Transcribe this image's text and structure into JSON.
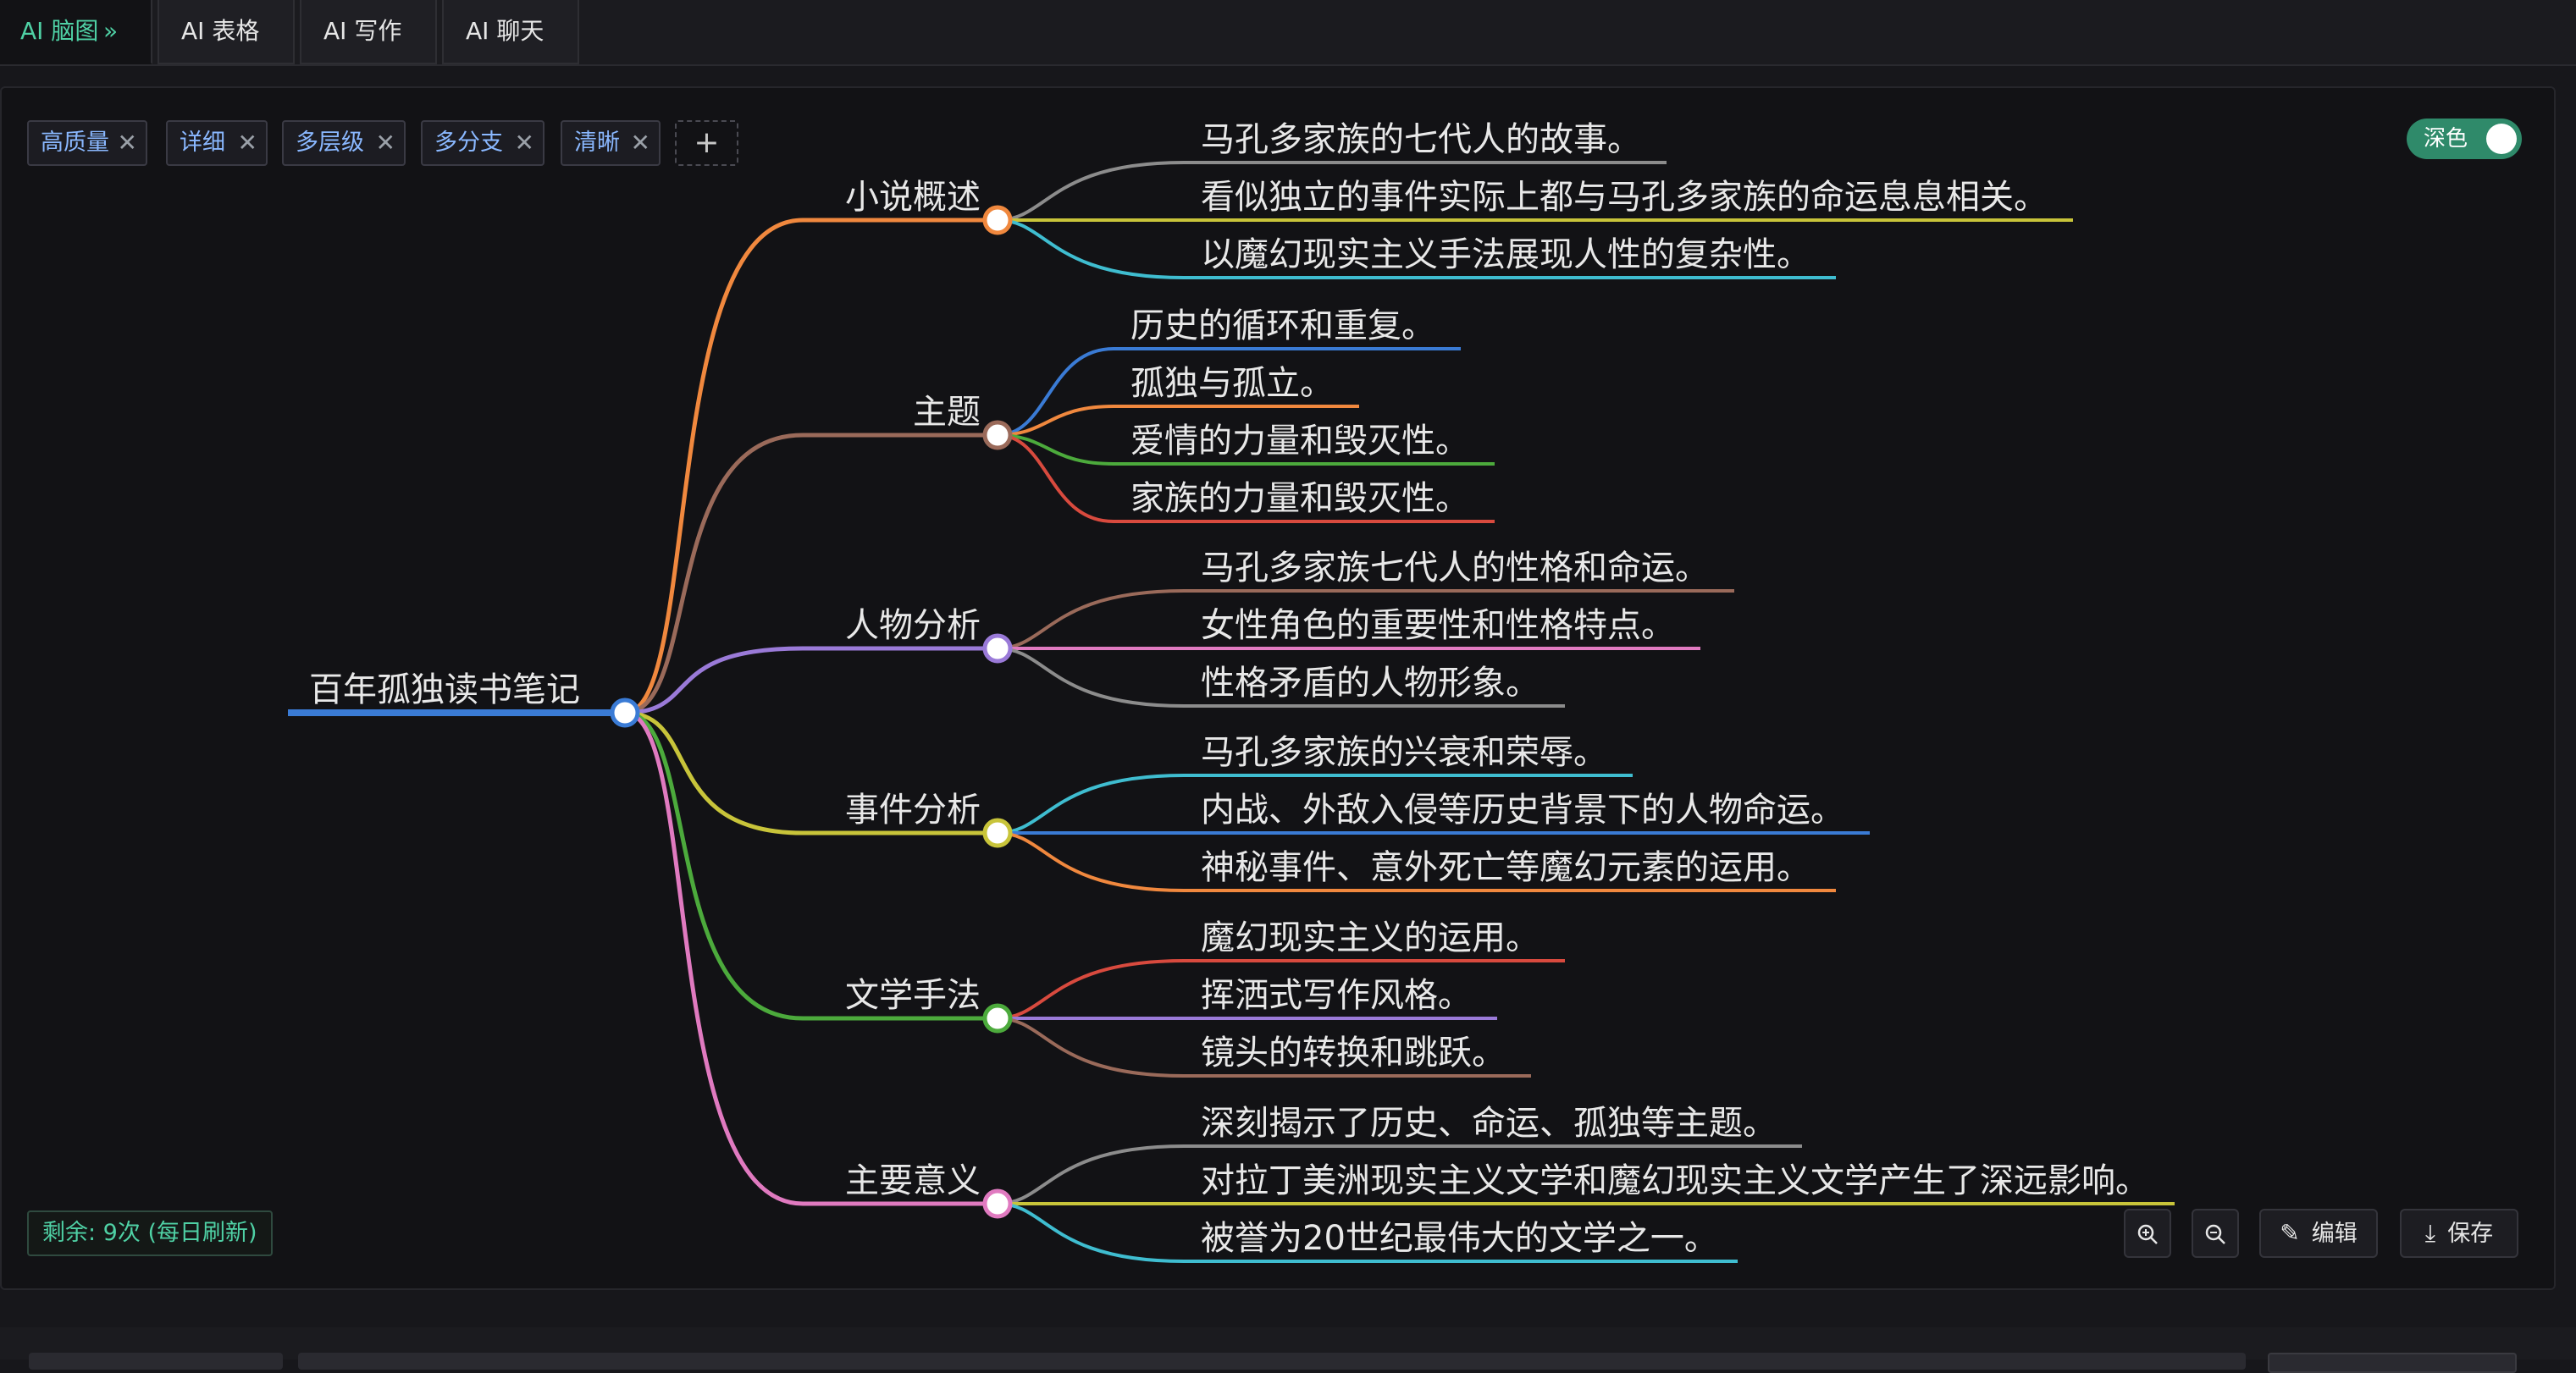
{
  "tabs": [
    {
      "label": "AI 脑图",
      "suffix": "»",
      "active": true
    },
    {
      "label": "AI 表格",
      "active": false
    },
    {
      "label": "AI 写作",
      "active": false
    },
    {
      "label": "AI 聊天",
      "active": false
    }
  ],
  "tags": [
    "高质量",
    "详细",
    "多层级",
    "多分支",
    "清晰"
  ],
  "add_tag_glyph": "+",
  "tag_remove_glyph": "✕",
  "theme_toggle": {
    "label": "深色",
    "on": true
  },
  "quota_text": "剩余: 9次 (每日刷新)",
  "toolbar": {
    "zoom_in_icon": "zoom-in-icon",
    "zoom_out_icon": "zoom-out-icon",
    "edit_label": "编辑",
    "save_label": "保存"
  },
  "colors": {
    "accent": "#4fd1a5",
    "background": "#121215"
  },
  "mindmap": {
    "root": {
      "text": "百年孤独读书笔记",
      "color": "#3a7bd5"
    },
    "branches": [
      {
        "title": "小说概述",
        "color": "#f0883e",
        "children": [
          {
            "text": "马孔多家族的七代人的故事。",
            "color": "#8c8c8c"
          },
          {
            "text": "看似独立的事件实际上都与马孔多家族的命运息息相关。",
            "color": "#c8c43a"
          },
          {
            "text": "以魔幻现实主义手法展现人性的复杂性。",
            "color": "#3fbdd0"
          }
        ]
      },
      {
        "title": "主题",
        "color": "#9a6a5a",
        "children": [
          {
            "text": "历史的循环和重复。",
            "color": "#3a7bd5"
          },
          {
            "text": "孤独与孤立。",
            "color": "#f0883e"
          },
          {
            "text": "爱情的力量和毁灭性。",
            "color": "#4caa3c"
          },
          {
            "text": "家族的力量和毁灭性。",
            "color": "#d84a3e"
          }
        ]
      },
      {
        "title": "人物分析",
        "color": "#9a7ad8",
        "children": [
          {
            "text": "马孔多家族七代人的性格和命运。",
            "color": "#9a6a5a"
          },
          {
            "text": "女性角色的重要性和性格特点。",
            "color": "#e07ac0"
          },
          {
            "text": "性格矛盾的人物形象。",
            "color": "#8c8c8c"
          }
        ]
      },
      {
        "title": "事件分析",
        "color": "#c8c43a",
        "children": [
          {
            "text": "马孔多家族的兴衰和荣辱。",
            "color": "#3fbdd0"
          },
          {
            "text": "内战、外敌入侵等历史背景下的人物命运。",
            "color": "#3a7bd5"
          },
          {
            "text": "神秘事件、意外死亡等魔幻元素的运用。",
            "color": "#f0883e"
          }
        ]
      },
      {
        "title": "文学手法",
        "color": "#4caa3c",
        "children": [
          {
            "text": "魔幻现实主义的运用。",
            "color": "#d84a3e"
          },
          {
            "text": "挥洒式写作风格。",
            "color": "#9a7ad8"
          },
          {
            "text": "镜头的转换和跳跃。",
            "color": "#9a6a5a"
          }
        ]
      },
      {
        "title": "主要意义",
        "color": "#e07ac0",
        "children": [
          {
            "text": "深刻揭示了历史、命运、孤独等主题。",
            "color": "#8c8c8c"
          },
          {
            "text": "对拉丁美洲现实主义文学和魔幻现实主义文学产生了深远影响。",
            "color": "#c8c43a"
          },
          {
            "text": "被誉为20世纪最伟大的文学之一。",
            "color": "#3fbdd0"
          }
        ]
      }
    ]
  }
}
